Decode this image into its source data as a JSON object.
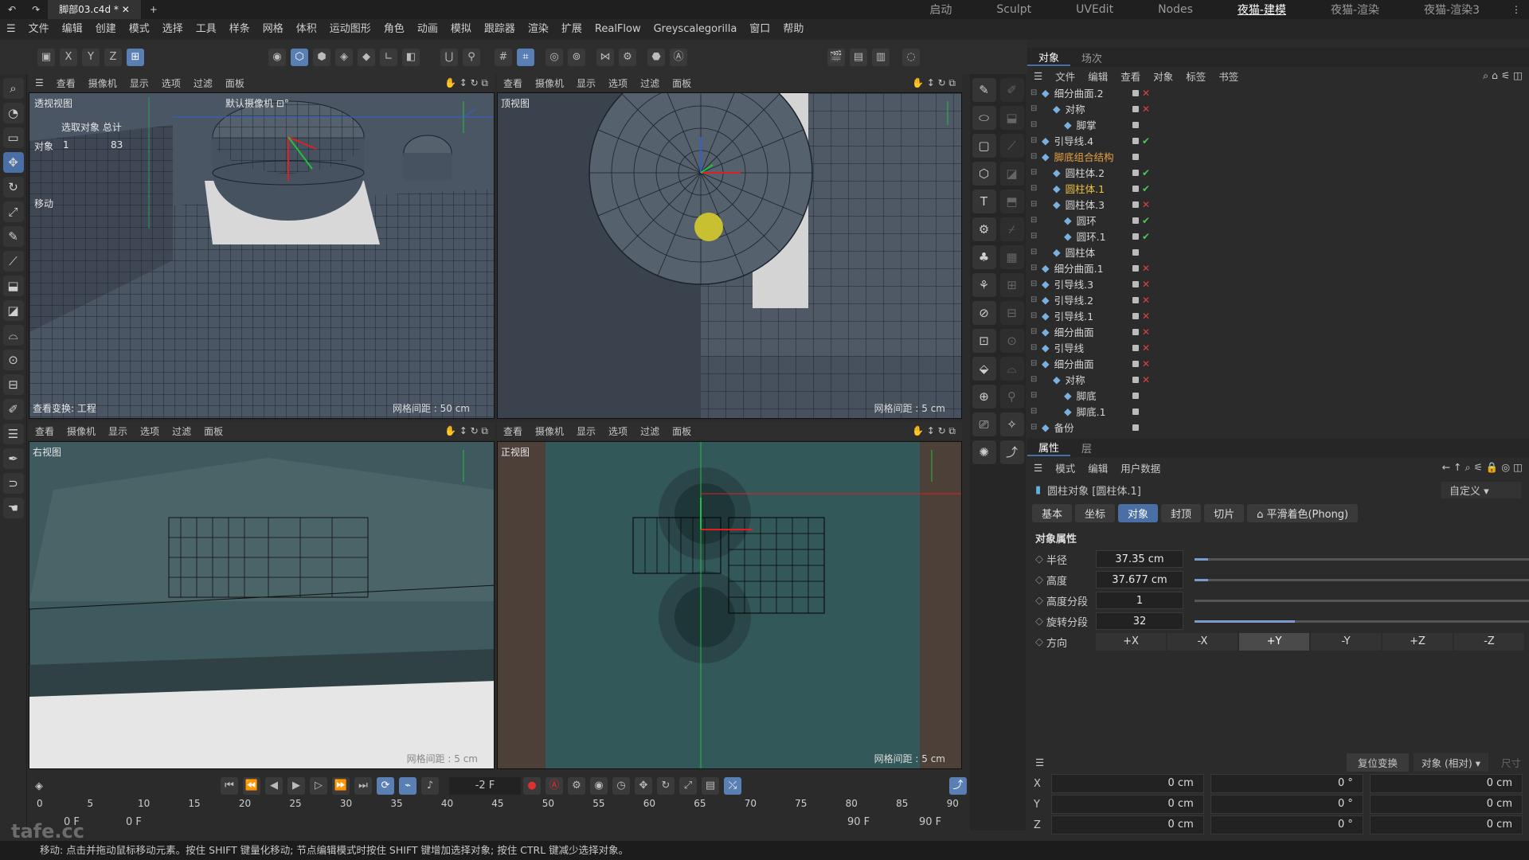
{
  "title_bar": {
    "doc_tab": "脚部03.c4d *",
    "layouts": [
      "启动",
      "Sculpt",
      "UVEdit",
      "Nodes",
      "夜猫-建模",
      "夜猫-渲染",
      "夜猫-渲染3"
    ],
    "active_layout_index": 4
  },
  "menu": [
    "文件",
    "编辑",
    "创建",
    "模式",
    "选择",
    "工具",
    "样条",
    "网格",
    "体积",
    "运动图形",
    "角色",
    "动画",
    "模拟",
    "跟踪器",
    "渲染",
    "扩展",
    "RealFlow",
    "Greyscalegorilla",
    "窗口",
    "帮助"
  ],
  "axes": [
    "X",
    "Y",
    "Z"
  ],
  "viewport_menu": [
    "查看",
    "摄像机",
    "显示",
    "选项",
    "过滤",
    "面板"
  ],
  "viewports": {
    "perspective": {
      "label": "透视视图",
      "camera": "默认摄像机 ⊡°",
      "hud_head": "选取对象 总计",
      "hud_obj": "对象",
      "hud_sel": "1",
      "hud_total": "83",
      "move": "移动",
      "transform": "查看变换: 工程",
      "grid": "网格间距 : 50 cm"
    },
    "top": {
      "label": "顶视图",
      "grid": "网格间距 : 5 cm"
    },
    "right": {
      "label": "右视图",
      "grid": "网格间距 : 5 cm"
    },
    "front": {
      "label": "正视图",
      "grid": "网格间距 : 5 cm"
    }
  },
  "objects_panel": {
    "tabs": [
      "对象",
      "场次"
    ],
    "menu": [
      "文件",
      "编辑",
      "查看",
      "对象",
      "标签",
      "书签"
    ],
    "items": [
      {
        "name": "细分曲面.2",
        "state": "x"
      },
      {
        "name": "对称",
        "state": "x"
      },
      {
        "name": "脚掌",
        "state": ""
      },
      {
        "name": "引导线.4",
        "state": "check"
      },
      {
        "name": "脚底组合结构",
        "state": "",
        "highlight": "#e8a040"
      },
      {
        "name": "圆柱体.2",
        "state": "check"
      },
      {
        "name": "圆柱体.1",
        "state": "check",
        "highlight": "#f0c040"
      },
      {
        "name": "圆柱体.3",
        "state": "x"
      },
      {
        "name": "圆环",
        "state": "check"
      },
      {
        "name": "圆环.1",
        "state": "check"
      },
      {
        "name": "圆柱体",
        "state": ""
      },
      {
        "name": "细分曲面.1",
        "state": "x"
      },
      {
        "name": "引导线.3",
        "state": "x"
      },
      {
        "name": "引导线.2",
        "state": "x"
      },
      {
        "name": "引导线.1",
        "state": "x"
      },
      {
        "name": "细分曲面",
        "state": "x"
      },
      {
        "name": "引导线",
        "state": "x"
      },
      {
        "name": "细分曲面",
        "state": "x"
      },
      {
        "name": "对称",
        "state": "x"
      },
      {
        "name": "脚底",
        "state": ""
      },
      {
        "name": "脚底.1",
        "state": ""
      },
      {
        "name": "备份",
        "state": ""
      }
    ]
  },
  "attributes": {
    "tabs": [
      "属性",
      "层"
    ],
    "menu": [
      "模式",
      "编辑",
      "用户数据"
    ],
    "object_title": "圆柱对象 [圆柱体.1]",
    "preset": "自定义",
    "subtabs": [
      "基本",
      "坐标",
      "对象",
      "封顶",
      "切片",
      "⌂ 平滑着色(Phong)"
    ],
    "section": "对象属性",
    "props": [
      {
        "name": "半径",
        "value": "37.35 cm",
        "fill": 0.04
      },
      {
        "name": "高度",
        "value": "37.677 cm",
        "fill": 0.04
      },
      {
        "name": "高度分段",
        "value": "1",
        "fill": 0.0
      },
      {
        "name": "旋转分段",
        "value": "32",
        "fill": 0.3
      }
    ],
    "dir_label": "方向",
    "directions": [
      "+X",
      "-X",
      "+Y",
      "-Y",
      "+Z",
      "-Z"
    ],
    "dir_selected": 2
  },
  "coords": {
    "reset": "复位变换",
    "mode": "对象 (相对)",
    "size": "尺寸",
    "rows": [
      {
        "axis": "X",
        "p": "0 cm",
        "r": "0 °",
        "s": "0 cm"
      },
      {
        "axis": "Y",
        "p": "0 cm",
        "r": "0 °",
        "s": "0 cm"
      },
      {
        "axis": "Z",
        "p": "0 cm",
        "r": "0 °",
        "s": "0 cm"
      }
    ]
  },
  "timeline": {
    "frame": "-2 F",
    "start": "0 F",
    "start2": "0 F",
    "end": "90 F",
    "end2": "90 F",
    "ticks": [
      "0",
      "5",
      "10",
      "15",
      "20",
      "25",
      "30",
      "35",
      "40",
      "45",
      "50",
      "55",
      "60",
      "65",
      "70",
      "75",
      "80",
      "85",
      "90"
    ]
  },
  "watermark": "tafe.cc",
  "status": "移动: 点击并拖动鼠标移动元素。按住 SHIFT 键量化移动; 节点编辑模式时按住 SHIFT 键增加选择对象; 按住 CTRL 键减少选择对象。",
  "colors": {
    "accent": "#4a6fa5",
    "mesh": "#4a5868",
    "bg_photo": "#2e4c4c"
  }
}
